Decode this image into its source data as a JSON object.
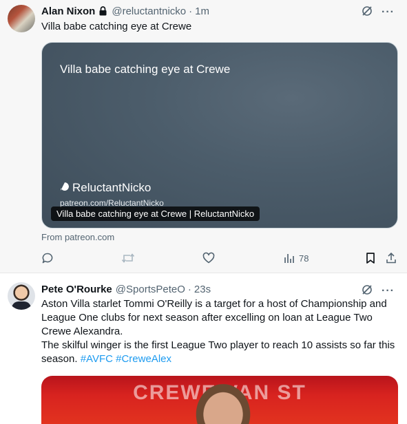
{
  "tweets": [
    {
      "author": "Alan Nixon",
      "handle": "@reluctantnicko",
      "separator": "·",
      "time": "1m",
      "text": "Villa babe catching eye at Crewe",
      "card": {
        "title": "Villa babe catching eye at Crewe",
        "brand": "ReluctantNicko",
        "url": "patreon.com/ReluctantNicko",
        "caption": "Villa babe catching eye at Crewe | ReluctantNicko"
      },
      "source": "From patreon.com",
      "views": "78"
    },
    {
      "author": "Pete O'Rourke",
      "handle": "@SportsPeteO",
      "separator": "·",
      "time": "23s",
      "text_p1": "Aston Villa starlet Tommi O'Reilly is a target for a host of Championship and League One clubs for next season after excelling on loan at League Two Crewe Alexandra.",
      "text_p2": "The skilful winger is the first League Two player to reach 10 assists so far this season.",
      "hashtags": [
        "#AVFC",
        "#CreweAlex"
      ],
      "media_banner": "CREWE VAN ST"
    }
  ],
  "icons": {
    "lock": "lock-icon",
    "grok": "grok-icon",
    "more": "more-icon",
    "reply": "reply-icon",
    "retweet": "retweet-icon",
    "like": "like-icon",
    "views": "views-icon",
    "bookmark": "bookmark-icon",
    "share": "share-icon"
  },
  "colors": {
    "text": "#0f1419",
    "muted": "#536471",
    "link": "#1d9bf0",
    "card_bg": "#4c5d6b"
  }
}
